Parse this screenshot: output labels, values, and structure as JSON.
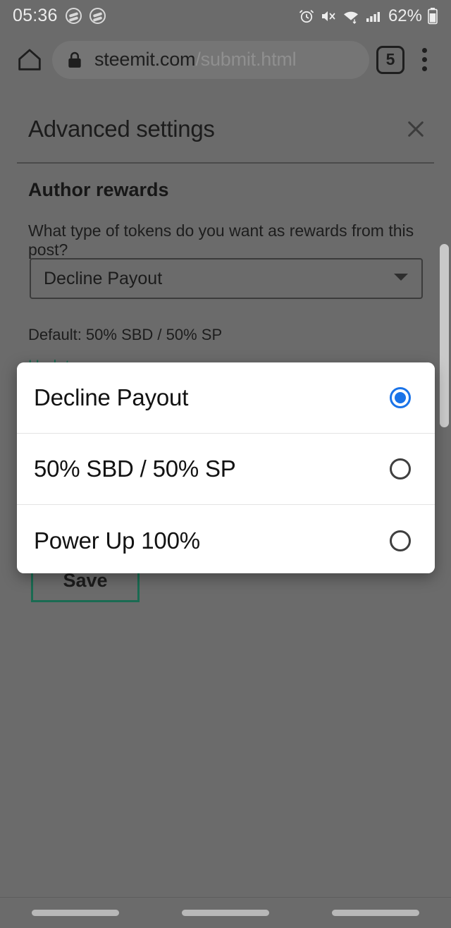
{
  "status_bar": {
    "clock": "05:36",
    "notification_icons": [
      "steemit-logo-icon",
      "steemit-logo-icon"
    ],
    "system_icons": [
      "alarm-icon",
      "mute-icon",
      "wifi-icon",
      "signal-icon"
    ],
    "battery_percent": "62%"
  },
  "browser": {
    "home_icon": "home-icon",
    "lock_icon": "lock-icon",
    "url_domain": "steemit.com",
    "url_path": "/submit.html",
    "tab_count": "5",
    "overflow_icon": "three-dot-menu-icon"
  },
  "page": {
    "modal_title": "Advanced settings",
    "close_icon": "close-icon",
    "section_title": "Author rewards",
    "section_description": "What type of tokens do you want as rewards from this post?",
    "select_value": "Decline Payout",
    "select_arrow_icon": "chevron-down-icon",
    "default_note": "Default: 50% SBD / 50% SP",
    "update_link": "Update",
    "save_label": "Save",
    "accent_color": "#1a6b52"
  },
  "dialog": {
    "selected_value": "Decline Payout",
    "radio_selected_color": "#1a73e8",
    "options": [
      {
        "label": "Decline Payout",
        "selected": true
      },
      {
        "label": "50% SBD / 50% SP",
        "selected": false
      },
      {
        "label": "Power Up 100%",
        "selected": false
      }
    ]
  },
  "nav_bar": {
    "pills": [
      "recents-pill",
      "home-pill",
      "back-pill"
    ]
  }
}
